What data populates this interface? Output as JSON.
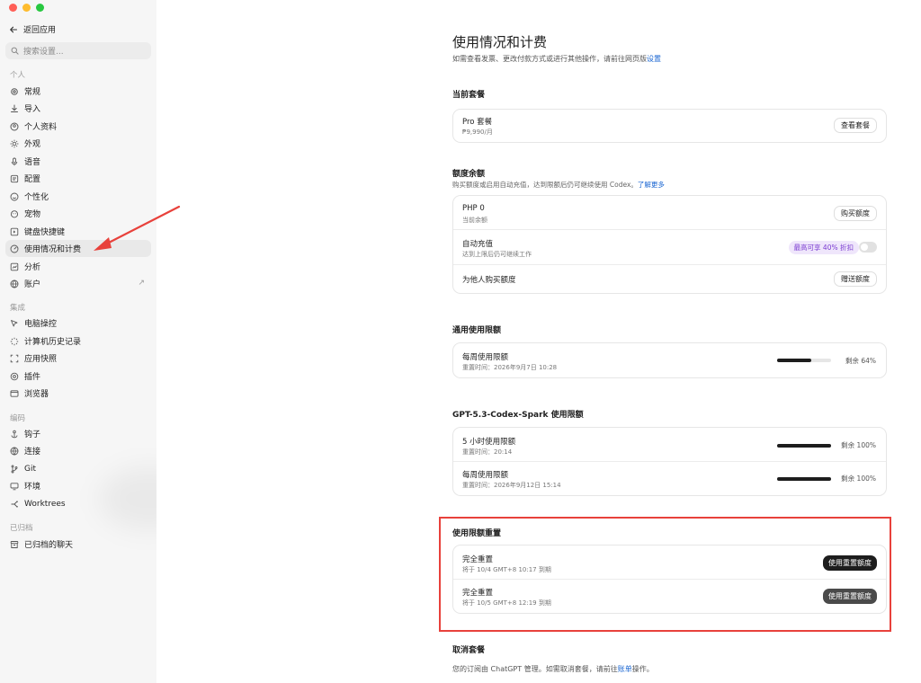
{
  "sidebar": {
    "back_label": "返回应用",
    "search_placeholder": "搜索设置...",
    "section_personal": "个人",
    "section_integrations": "集成",
    "section_coding": "编码",
    "section_archived": "已归档",
    "personal_items": [
      {
        "label": "常规",
        "icon": "gear-icon"
      },
      {
        "label": "导入",
        "icon": "download-icon"
      },
      {
        "label": "个人资料",
        "icon": "profile-icon"
      },
      {
        "label": "外观",
        "icon": "sun-icon"
      },
      {
        "label": "语音",
        "icon": "mic-icon"
      },
      {
        "label": "配置",
        "icon": "config-icon"
      },
      {
        "label": "个性化",
        "icon": "personalize-icon"
      },
      {
        "label": "宠物",
        "icon": "pet-icon"
      },
      {
        "label": "键盘快捷键",
        "icon": "keyboard-icon"
      },
      {
        "label": "使用情况和计费",
        "icon": "gauge-icon",
        "active": true
      },
      {
        "label": "分析",
        "icon": "chart-icon"
      },
      {
        "label": "账户",
        "icon": "account-icon"
      }
    ],
    "integration_items": [
      {
        "label": "电脑操控",
        "icon": "pointer-icon"
      },
      {
        "label": "计算机历史记录",
        "icon": "history-icon"
      },
      {
        "label": "应用快照",
        "icon": "snapshot-icon"
      },
      {
        "label": "插件",
        "icon": "plugin-icon"
      },
      {
        "label": "浏览器",
        "icon": "browser-icon"
      }
    ],
    "coding_items": [
      {
        "label": "钩子",
        "icon": "hook-icon"
      },
      {
        "label": "连接",
        "icon": "globe-icon"
      },
      {
        "label": "Git",
        "icon": "git-icon"
      },
      {
        "label": "环境",
        "icon": "monitor-icon"
      },
      {
        "label": "Worktrees",
        "icon": "worktree-icon"
      }
    ],
    "archived_items": [
      {
        "label": "已归档的聊天",
        "icon": "archive-icon"
      }
    ]
  },
  "main": {
    "title": "使用情况和计费",
    "subtitle_prefix": "如需查看发票、更改付款方式或进行其他操作，请前往网页版",
    "subtitle_link": "设置",
    "current_plan": {
      "section": "当前套餐",
      "name": "Pro 套餐",
      "price": "₱9,990/月",
      "button": "查看套餐"
    },
    "credits": {
      "section": "额度余额",
      "desc_prefix": "购买额度或启用自动充值，达到限额后仍可继续使用 Codex。",
      "desc_link": "了解更多",
      "balance_label": "PHP 0",
      "balance_sub": "当前余额",
      "buy_button": "购买额度",
      "auto_label": "自动充值",
      "auto_sub": "达到上限后仍可继续工作",
      "promo": "最高可享 40% 折扣",
      "gift_label": "为他人购买额度",
      "gift_button": "赠送额度"
    },
    "general_limits": {
      "section": "通用使用限额",
      "items": [
        {
          "label": "每周使用限额",
          "reset": "重置时间：2026年9月7日 10:28",
          "remaining_text": "剩余 64%",
          "remaining": 0.64
        }
      ]
    },
    "spark_limits": {
      "section": "GPT-5.3-Codex-Spark 使用限额",
      "items": [
        {
          "label": "5 小时使用限额",
          "reset": "重置时间：20:14",
          "remaining_text": "剩余 100%",
          "remaining": 1.0
        },
        {
          "label": "每周使用限额",
          "reset": "重置时间：2026年9月12日 15:14",
          "remaining_text": "剩余 100%",
          "remaining": 1.0
        }
      ]
    },
    "resets": {
      "section": "使用限额重置",
      "items": [
        {
          "label": "完全重置",
          "expiry": "将于 10/4 GMT+8 10:17 到期",
          "button": "使用重置额度"
        },
        {
          "label": "完全重置",
          "expiry": "将于 10/5 GMT+8 12:19 到期",
          "button": "使用重置额度"
        }
      ]
    },
    "cancel": {
      "section": "取消套餐",
      "text_prefix": "您的订阅由 ChatGPT 管理。如需取消套餐，请前往",
      "text_link": "账单",
      "text_suffix": "操作。"
    }
  },
  "colors": {
    "accent_link": "#1a66d2",
    "highlight_box": "#e8413b",
    "annotation_arrow": "#e8413b",
    "promo_text": "#7a3bd1"
  }
}
